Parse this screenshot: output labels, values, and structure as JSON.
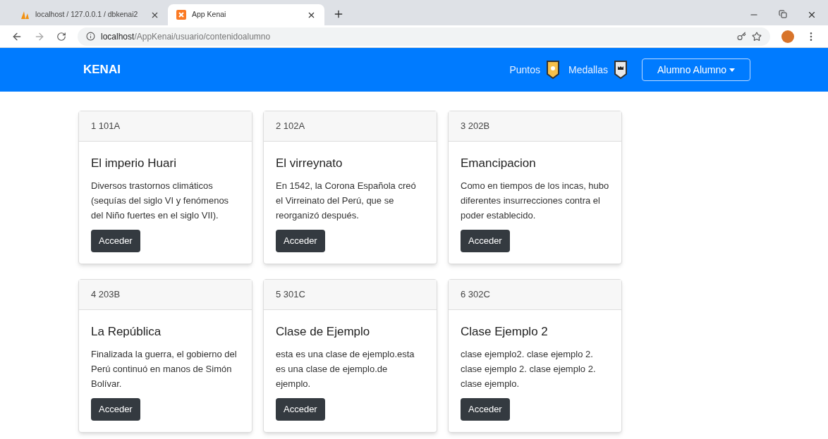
{
  "browser": {
    "tabs": [
      {
        "title": "localhost / 127.0.0.1 / dbkenai2",
        "selected": false
      },
      {
        "title": "App Kenai",
        "selected": true
      }
    ],
    "address": {
      "host": "localhost",
      "path": "/AppKenai/usuario/contenidoalumno"
    }
  },
  "navbar": {
    "brand": "KENAI",
    "links": [
      "Puntos",
      "Medallas"
    ],
    "user_menu": "Alumno Alumno"
  },
  "cards": [
    {
      "header": "1 101A",
      "title": "El imperio Huari",
      "text": "Diversos trastornos climáticos (sequías del siglo VI y fenómenos del Niño fuertes en el siglo VII).",
      "button": "Acceder"
    },
    {
      "header": "2 102A",
      "title": "El virreynato",
      "text": "En 1542, la Corona Española creó el Virreinato del Perú, que se reorganizó después.",
      "button": "Acceder"
    },
    {
      "header": "3 202B",
      "title": "Emancipacion",
      "text": "Como en tiempos de los incas, hubo diferentes insurrecciones contra el poder establecido.",
      "button": "Acceder"
    },
    {
      "header": "4 203B",
      "title": "La República",
      "text": "Finalizada la guerra, el gobierno del Perú continuó en manos de Simón Bolívar.",
      "button": "Acceder"
    },
    {
      "header": "5 301C",
      "title": "Clase de Ejemplo",
      "text": "esta es una clase de ejemplo.esta es una clase de ejemplo.de ejemplo.",
      "button": "Acceder"
    },
    {
      "header": "6 302C",
      "title": "Clase Ejemplo 2",
      "text": "clase ejemplo2. clase ejemplo 2. clase ejemplo 2. clase ejemplo 2. clase ejemplo.",
      "button": "Acceder"
    }
  ]
}
